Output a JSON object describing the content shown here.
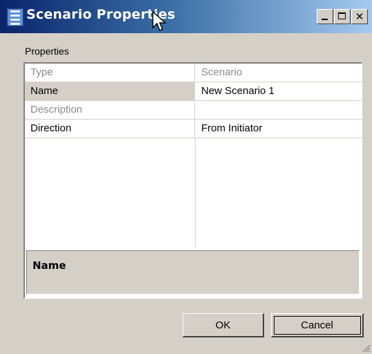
{
  "window": {
    "title": "Scenario Properties",
    "icon": "app-grid-icon",
    "controls": [
      "minimize-icon",
      "maximize-icon",
      "close-icon"
    ],
    "title_gradient": [
      "#0a246a",
      "#a6caf0"
    ]
  },
  "group_label": "Properties",
  "properties": [
    {
      "name": "Type",
      "value": "Scenario",
      "disabled": true
    },
    {
      "name": "Name",
      "value": "New Scenario 1",
      "selected": true
    },
    {
      "name": "Description",
      "value": "",
      "disabled": true
    },
    {
      "name": "Direction",
      "value": "From Initiator"
    }
  ],
  "description_panel": {
    "title": "Name"
  },
  "buttons": {
    "ok": "OK",
    "cancel": "Cancel"
  }
}
